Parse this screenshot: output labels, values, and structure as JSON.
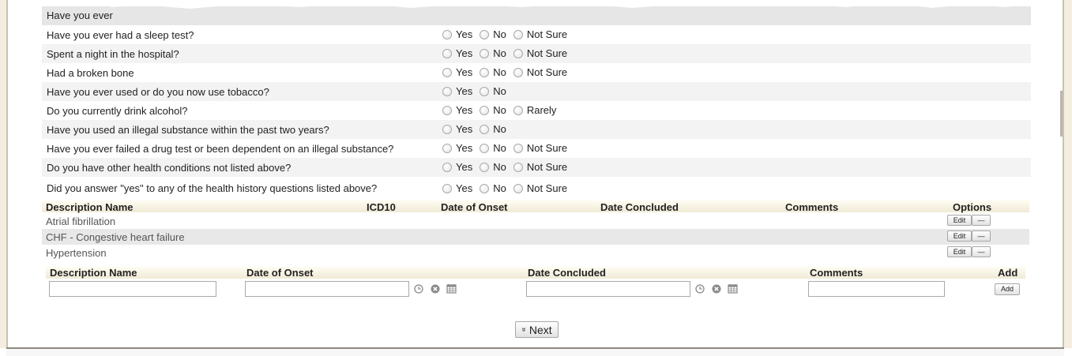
{
  "health_history": {
    "header": "Have you ever",
    "questions": [
      {
        "text": "Have you ever had a sleep test?",
        "options": [
          "Yes",
          "No",
          "Not Sure"
        ]
      },
      {
        "text": "Spent a night in the hospital?",
        "options": [
          "Yes",
          "No",
          "Not Sure"
        ]
      },
      {
        "text": "Had a broken bone",
        "options": [
          "Yes",
          "No",
          "Not Sure"
        ]
      },
      {
        "text": "Have you ever used or do you now use tobacco?",
        "options": [
          "Yes",
          "No"
        ]
      },
      {
        "text": "Do you currently drink alcohol?",
        "options": [
          "Yes",
          "No",
          "Rarely"
        ]
      },
      {
        "text": "Have you used an illegal substance within the past two years?",
        "options": [
          "Yes",
          "No"
        ]
      },
      {
        "text": "Have you ever failed a drug test or been dependent on an illegal substance?",
        "options": [
          "Yes",
          "No",
          "Not Sure"
        ]
      },
      {
        "text": "Do you have other health conditions not listed above?",
        "options": [
          "Yes",
          "No",
          "Not Sure"
        ]
      },
      {
        "text": "Did you answer \"yes\" to any of the health history questions listed above?",
        "options": [
          "Yes",
          "No",
          "Not Sure"
        ]
      }
    ]
  },
  "conditions_table": {
    "columns": [
      "Description Name",
      "ICD10",
      "Date of Onset",
      "Date Concluded",
      "Comments",
      "Options"
    ],
    "rows": [
      {
        "name": "Atrial fibrillation"
      },
      {
        "name": "CHF - Congestive heart failure"
      },
      {
        "name": "Hypertension"
      }
    ],
    "edit_label": "Edit",
    "remove_label": "—"
  },
  "add_form": {
    "columns": [
      "Description Name",
      "Date of Onset",
      "Date Concluded",
      "Comments",
      "Add"
    ],
    "add_button_label": "Add",
    "description_value": "",
    "onset_value": "",
    "concluded_value": "",
    "comments_value": ""
  },
  "next_button": {
    "label": "Next",
    "icon": "chevron-double-down-icon"
  },
  "colors": {
    "header_gradient_top": "#fffcf2",
    "header_gradient_bottom": "#f0ead6",
    "row_shade": "#f3f3f3",
    "frame": "#f4eee0"
  }
}
